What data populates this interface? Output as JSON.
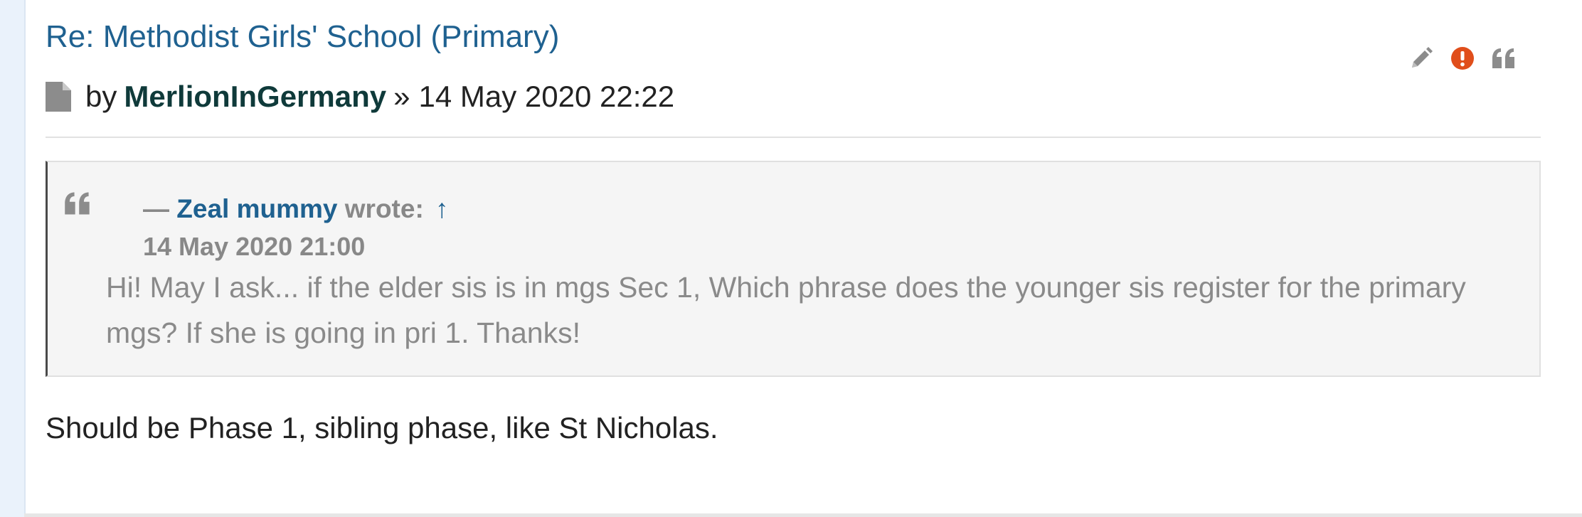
{
  "post": {
    "title": "Re: Methodist Girls' School (Primary)",
    "by_label": "by",
    "author": "MerlionInGermany",
    "separator": "»",
    "date": "14 May 2020 22:22",
    "icons": {
      "post": "file-icon",
      "edit": "pencil-icon",
      "report": "exclamation-circle-icon",
      "quote": "quote-icon"
    }
  },
  "quote": {
    "dash": "—",
    "author": "Zeal mummy",
    "wrote_label": "wrote:",
    "jump_symbol": "↑",
    "date": "14 May 2020 21:00",
    "text": "Hi! May I ask... if the elder sis is in mgs Sec 1, Which phrase does the younger sis register for the primary mgs? If she is going in pri 1. Thanks!"
  },
  "reply": {
    "text": "Should be Phase 1, sibling phase, like St Nicholas."
  },
  "colors": {
    "link": "#1f6190",
    "author": "#0f3a3a",
    "report_icon": "#e04e1b",
    "icon_gray": "#8c8c8c",
    "quote_bg": "#f5f5f5"
  }
}
